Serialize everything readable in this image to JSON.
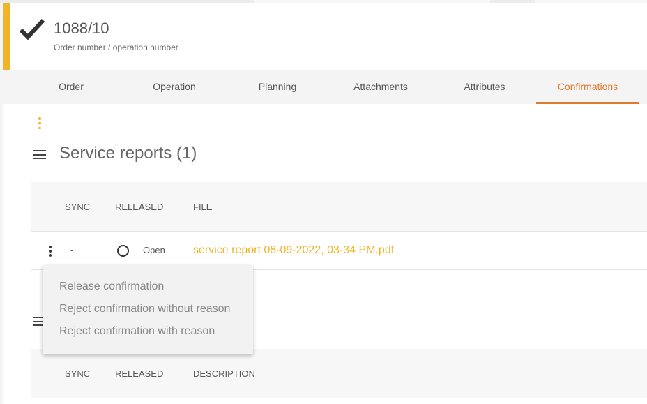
{
  "header": {
    "title": "1088/10",
    "subtitle": "Order number / operation number",
    "accent_color": "#f0b429",
    "icon": "check-icon"
  },
  "tabs": [
    {
      "label": "Order",
      "active": false
    },
    {
      "label": "Operation",
      "active": false
    },
    {
      "label": "Planning",
      "active": false
    },
    {
      "label": "Attachments",
      "active": false
    },
    {
      "label": "Attributes",
      "active": false
    },
    {
      "label": "Confirmations",
      "active": true
    }
  ],
  "active_tab_color": "#e07a2e",
  "service_reports": {
    "title": "Service reports (1)",
    "columns": [
      "SYNC",
      "RELEASED",
      "FILE"
    ],
    "rows": [
      {
        "sync": "-",
        "released": "Open",
        "file": "service report 08-09-2022, 03-34 PM.pdf"
      }
    ]
  },
  "second_section": {
    "columns": [
      "SYNC",
      "RELEASED",
      "DESCRIPTION"
    ]
  },
  "context_menu": {
    "items": [
      "Release confirmation",
      "Reject confirmation without reason",
      "Reject confirmation with reason"
    ]
  }
}
